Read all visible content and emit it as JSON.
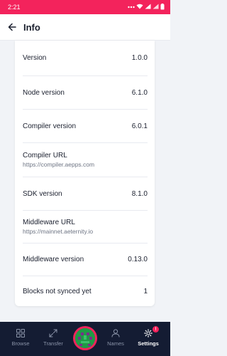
{
  "status_bar": {
    "time": "2:21",
    "battery": "▮"
  },
  "header": {
    "title": "Info"
  },
  "info_rows": [
    {
      "label": "Version",
      "value": "1.0.0"
    },
    {
      "label": "Node version",
      "value": "6.1.0"
    },
    {
      "label": "Compiler version",
      "value": "6.0.1"
    },
    {
      "label": "Compiler URL",
      "sub": "https://compiler.aepps.com"
    },
    {
      "label": "SDK version",
      "value": "8.1.0"
    },
    {
      "label": "Middleware URL",
      "sub": "https://mainnet.aeternity.io"
    },
    {
      "label": "Middleware version",
      "value": "0.13.0"
    },
    {
      "label": "Blocks not synced yet",
      "value": "1"
    }
  ],
  "bottom_nav": {
    "items": [
      {
        "label": "Browse",
        "icon": "grid-icon"
      },
      {
        "label": "Transfer",
        "icon": "expand-arrows-icon"
      },
      {
        "label": "Names",
        "icon": "user-icon"
      },
      {
        "label": "Settings",
        "icon": "gear-icon",
        "active": true,
        "badge": "!"
      }
    ],
    "avatar_icon": "identicon-avatar"
  },
  "colors": {
    "accent": "#f3235c",
    "nav_bg": "#141c33",
    "page_bg": "#f1f3f7",
    "avatar_green": "#1f9a46"
  }
}
